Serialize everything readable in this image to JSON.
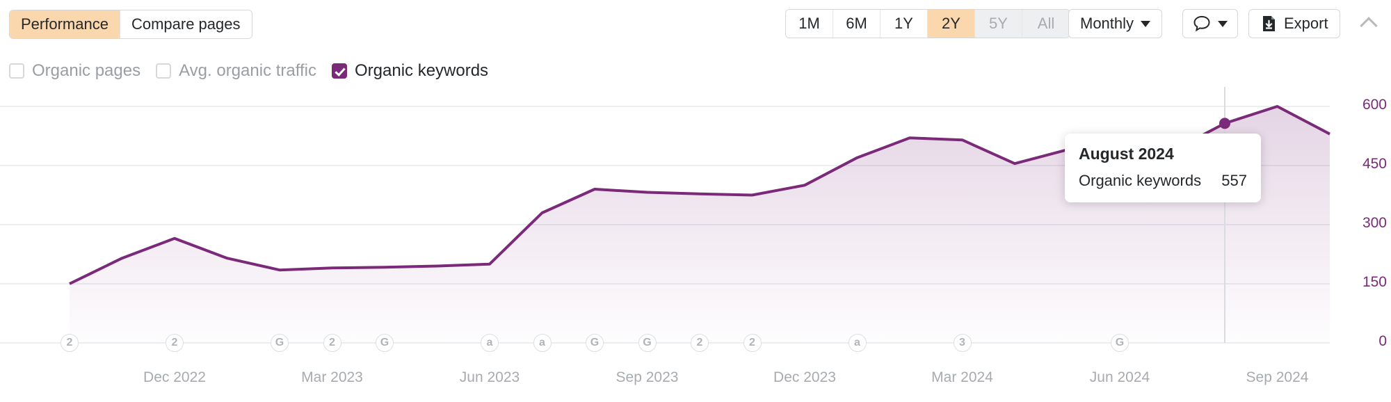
{
  "toolbar": {
    "view_tabs": [
      {
        "label": "Performance",
        "active": true
      },
      {
        "label": "Compare pages",
        "active": false
      }
    ],
    "range_tabs": [
      {
        "label": "1M",
        "state": "normal"
      },
      {
        "label": "6M",
        "state": "normal"
      },
      {
        "label": "1Y",
        "state": "normal"
      },
      {
        "label": "2Y",
        "state": "active"
      },
      {
        "label": "5Y",
        "state": "disabled"
      },
      {
        "label": "All",
        "state": "disabled"
      }
    ],
    "granularity_label": "Monthly",
    "export_label": "Export",
    "annotations_icon": "speech-bubble-icon",
    "collapse_icon": "chevron-up-icon"
  },
  "legend": [
    {
      "label": "Organic pages",
      "checked": false
    },
    {
      "label": "Avg. organic traffic",
      "checked": false
    },
    {
      "label": "Organic keywords",
      "checked": true
    }
  ],
  "tooltip": {
    "title": "August 2024",
    "metric": "Organic keywords",
    "value": "557"
  },
  "colors": {
    "accent_active": "#fbd7ad",
    "series_line": "#7a2a78",
    "axis_text": "#a7abb0",
    "y_axis_text": "#7a2a78"
  },
  "chart_data": {
    "type": "area",
    "title": "",
    "xlabel": "",
    "ylabel": "",
    "ylim": [
      0,
      600
    ],
    "yticks": [
      0,
      150,
      300,
      450,
      600
    ],
    "grid": true,
    "legend_position": "top-left",
    "x_tick_labels": [
      "Dec 2022",
      "Mar 2023",
      "Jun 2023",
      "Sep 2023",
      "Dec 2023",
      "Mar 2024",
      "Jun 2024",
      "Sep 2024"
    ],
    "series": [
      {
        "name": "Organic keywords",
        "categories": [
          "Oct 2022",
          "Nov 2022",
          "Dec 2022",
          "Jan 2023",
          "Feb 2023",
          "Mar 2023",
          "Apr 2023",
          "May 2023",
          "Jun 2023",
          "Jul 2023",
          "Aug 2023",
          "Sep 2023",
          "Oct 2023",
          "Nov 2023",
          "Dec 2023",
          "Jan 2024",
          "Feb 2024",
          "Mar 2024",
          "Apr 2024",
          "May 2024",
          "Jun 2024",
          "Jul 2024",
          "Aug 2024",
          "Sep 2024"
        ],
        "values": [
          150,
          215,
          265,
          215,
          185,
          190,
          192,
          195,
          200,
          330,
          390,
          382,
          378,
          375,
          400,
          470,
          520,
          515,
          455,
          490,
          492,
          487,
          557,
          600,
          530
        ]
      }
    ],
    "highlight_point": {
      "category": "August 2024",
      "value": 557
    },
    "event_markers": [
      {
        "x_category": "Oct 2022",
        "glyph": "2"
      },
      {
        "x_category": "Dec 2022",
        "glyph": "2"
      },
      {
        "x_category": "Feb 2023",
        "glyph": "G"
      },
      {
        "x_category": "Mar 2023",
        "glyph": "2"
      },
      {
        "x_category": "Apr 2023",
        "glyph": "G"
      },
      {
        "x_category": "Jun 2023",
        "glyph": "a"
      },
      {
        "x_category": "Jul 2023",
        "glyph": "a"
      },
      {
        "x_category": "Aug 2023",
        "glyph": "G"
      },
      {
        "x_category": "Sep 2023",
        "glyph": "G"
      },
      {
        "x_category": "Oct 2023",
        "glyph": "2"
      },
      {
        "x_category": "Nov 2023",
        "glyph": "2"
      },
      {
        "x_category": "Jan 2024",
        "glyph": "a"
      },
      {
        "x_category": "Mar 2024",
        "glyph": "3"
      },
      {
        "x_category": "Jun 2024",
        "glyph": "G"
      }
    ]
  }
}
